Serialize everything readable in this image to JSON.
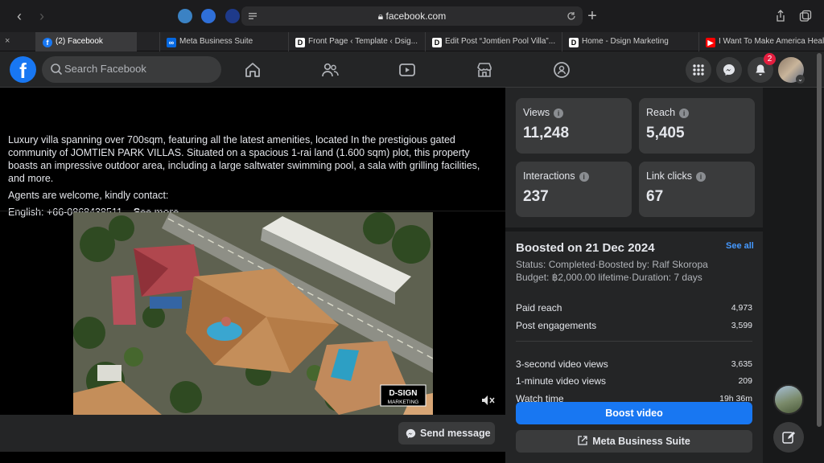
{
  "browser": {
    "url": "facebook.com",
    "tabs": [
      {
        "label": "(2) Facebook"
      },
      {
        "label": "Meta Business Suite"
      },
      {
        "label": "Front Page ‹ Template ‹ Dsig..."
      },
      {
        "label": "Edit Post “Jomtien Pool Villa”..."
      },
      {
        "label": "Home - Dsign Marketing"
      },
      {
        "label": "I Want To Make America Heal..."
      }
    ]
  },
  "header": {
    "logo": "f",
    "search_placeholder": "Search Facebook",
    "notification_count": "2"
  },
  "post": {
    "caption_p1": "Luxury villa spanning over 700sqm, featuring all the latest amenities, located In the prestigious gated community of JOMTIEN PARK VILLAS. Situated on a spacious 1-rai land (1.600 sqm) plot, this property boasts an impressive outdoor area, including a large saltwater swimming pool, a sala with grilling facilities, and more.",
    "caption_p2": "Agents are welcome, kindly contact:",
    "caption_p3": "English: +66-0868438511...",
    "see_more": "See more",
    "watermark_line1": "D-SIGN",
    "watermark_line2": "MARKETING",
    "send_message": "Send message"
  },
  "insights": {
    "views_label": "Views",
    "views_value": "11,248",
    "reach_label": "Reach",
    "reach_value": "5,405",
    "interactions_label": "Interactions",
    "interactions_value": "237",
    "link_clicks_label": "Link clicks",
    "link_clicks_value": "67",
    "info_glyph": "i"
  },
  "boost": {
    "title": "Boosted on 21 Dec 2024",
    "see_all": "See all",
    "status_line": "Status: Completed·Boosted by: Ralf Skoropa",
    "budget_line": "Budget: ฿2,000.00 lifetime·Duration: 7 days",
    "rows": [
      {
        "label": "Paid reach",
        "value": "4,973"
      },
      {
        "label": "Post engagements",
        "value": "3,599"
      },
      {
        "label": "3-second video views",
        "value": "3,635"
      },
      {
        "label": "1-minute video views",
        "value": "209"
      },
      {
        "label": "Watch time",
        "value": "19h 36m"
      }
    ],
    "boost_video": "Boost video",
    "meta_business_suite": "Meta Business Suite"
  }
}
